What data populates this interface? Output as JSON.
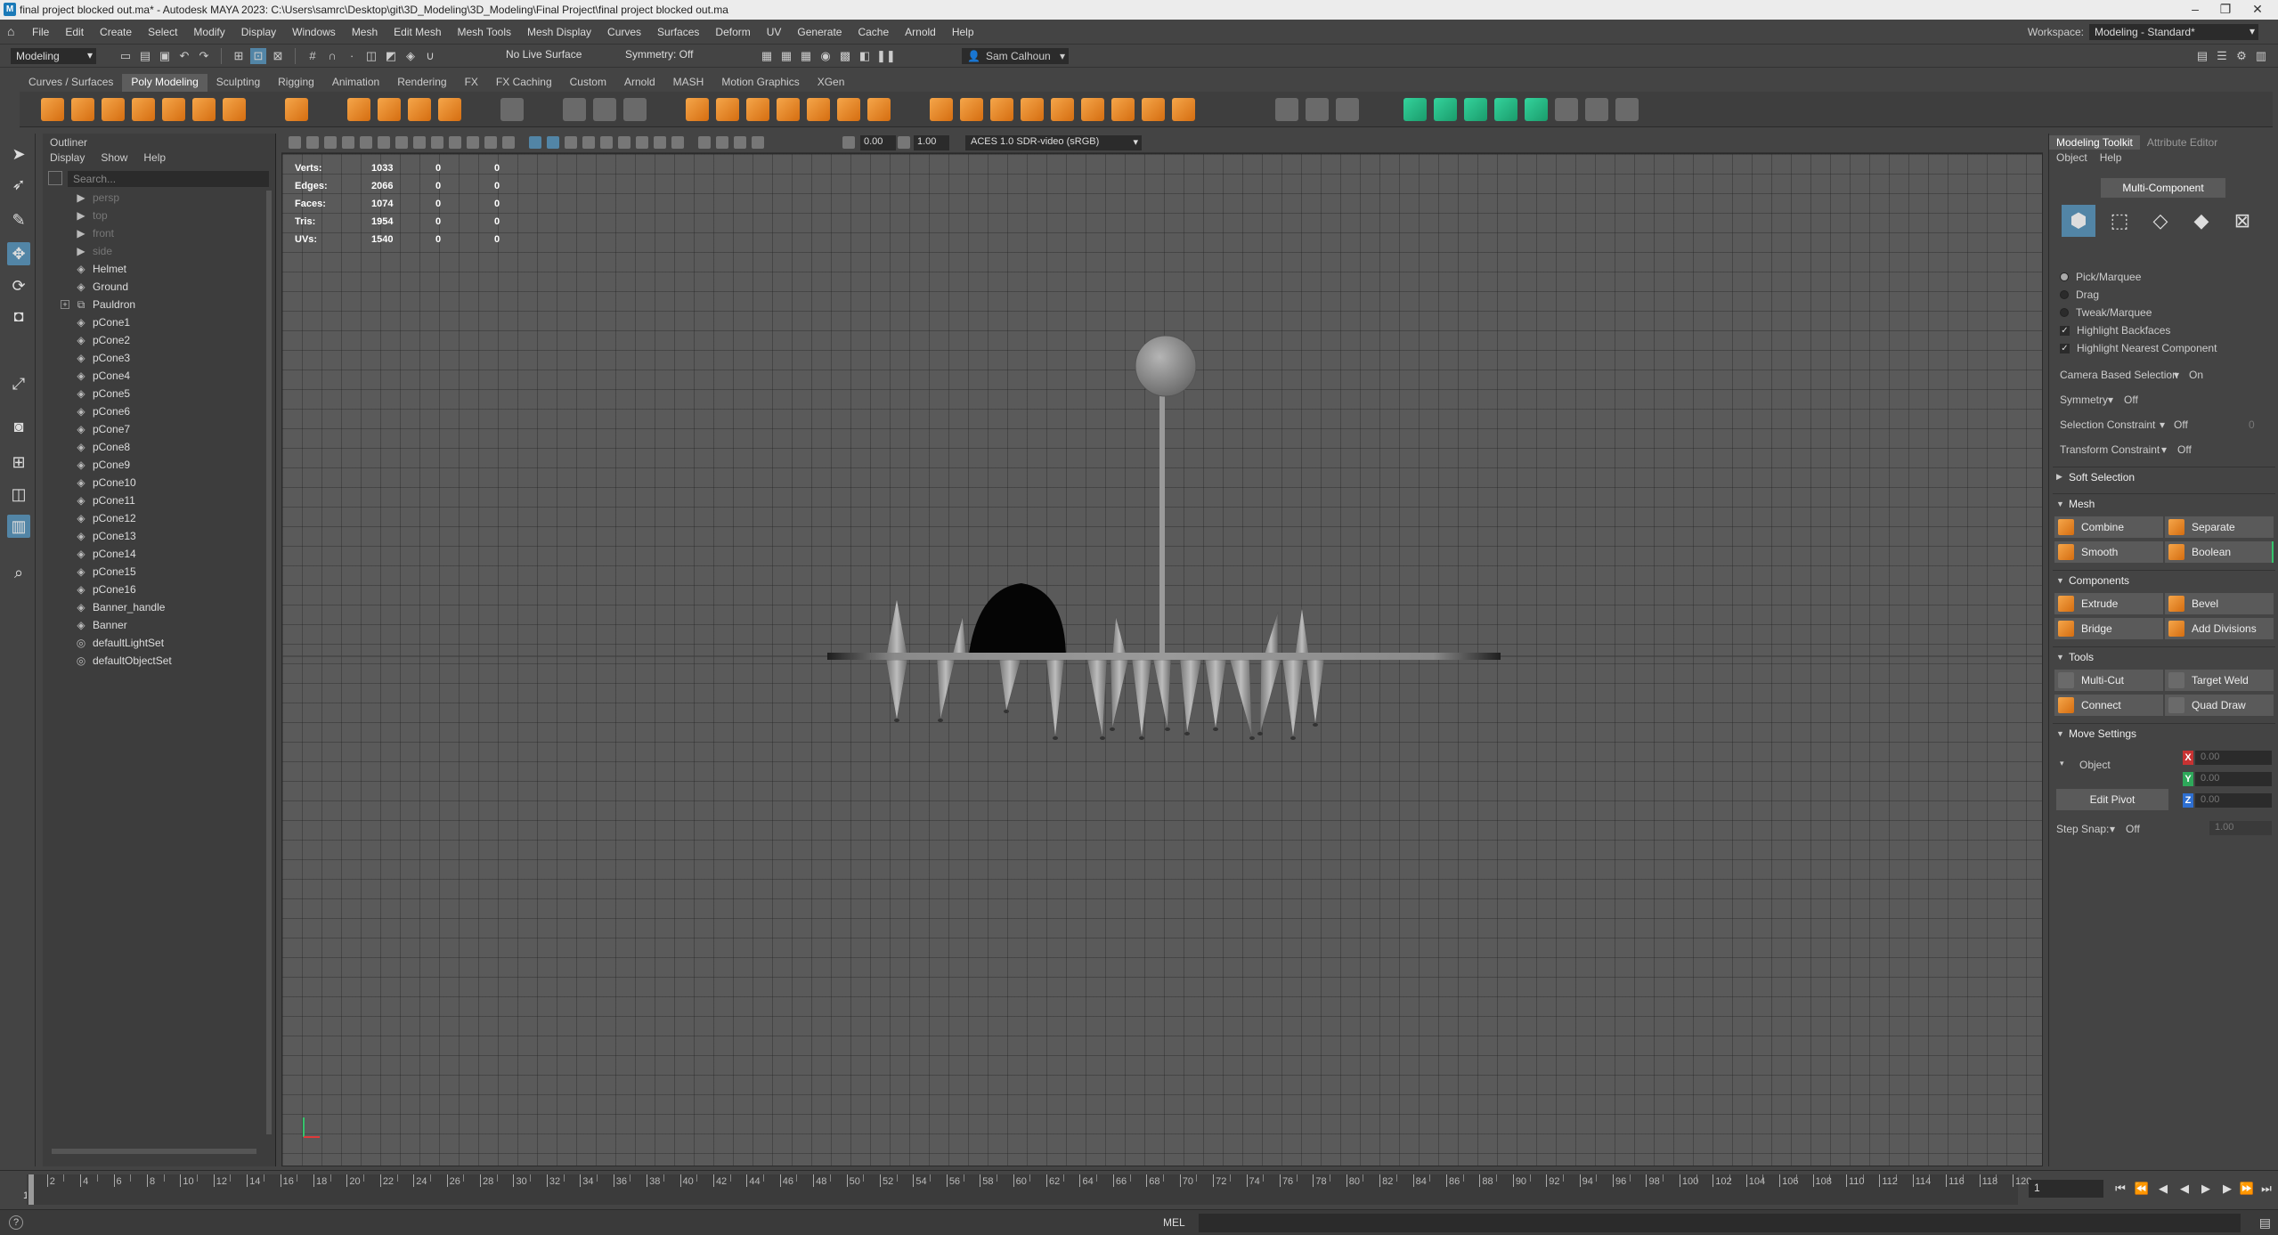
{
  "window": {
    "title": "final project blocked out.ma* - Autodesk MAYA 2023: C:\\Users\\samrc\\Desktop\\git\\3D_Modeling\\3D_Modeling\\Final Project\\final project blocked out.ma"
  },
  "menubar": {
    "items": [
      "File",
      "Edit",
      "Create",
      "Select",
      "Modify",
      "Display",
      "Windows",
      "Mesh",
      "Edit Mesh",
      "Mesh Tools",
      "Mesh Display",
      "Curves",
      "Surfaces",
      "Deform",
      "UV",
      "Generate",
      "Cache",
      "Arnold",
      "Help"
    ],
    "workspace_label": "Workspace:",
    "workspace_value": "Modeling - Standard*"
  },
  "statusline": {
    "mode": "Modeling",
    "live_surface": "No Live Surface",
    "symmetry": "Symmetry: Off",
    "user": "Sam Calhoun"
  },
  "shelf": {
    "tabs": [
      "Curves / Surfaces",
      "Poly Modeling",
      "Sculpting",
      "Rigging",
      "Animation",
      "Rendering",
      "FX",
      "FX Caching",
      "Custom",
      "Arnold",
      "MASH",
      "Motion Graphics",
      "XGen"
    ],
    "active_tab": "Poly Modeling"
  },
  "outliner": {
    "title": "Outliner",
    "menu": [
      "Display",
      "Show",
      "Help"
    ],
    "search_placeholder": "Search...",
    "items": [
      {
        "label": "persp",
        "icon": "camera-icon",
        "dim": true
      },
      {
        "label": "top",
        "icon": "camera-icon",
        "dim": true
      },
      {
        "label": "front",
        "icon": "camera-icon",
        "dim": true
      },
      {
        "label": "side",
        "icon": "camera-icon",
        "dim": true
      },
      {
        "label": "Helmet",
        "icon": "mesh-icon",
        "dim": false
      },
      {
        "label": "Ground",
        "icon": "mesh-icon",
        "dim": false
      },
      {
        "label": "Pauldron",
        "icon": "group-icon",
        "dim": false,
        "expandable": true
      },
      {
        "label": "pCone1",
        "icon": "mesh-icon",
        "dim": false
      },
      {
        "label": "pCone2",
        "icon": "mesh-icon",
        "dim": false
      },
      {
        "label": "pCone3",
        "icon": "mesh-icon",
        "dim": false
      },
      {
        "label": "pCone4",
        "icon": "mesh-icon",
        "dim": false
      },
      {
        "label": "pCone5",
        "icon": "mesh-icon",
        "dim": false
      },
      {
        "label": "pCone6",
        "icon": "mesh-icon",
        "dim": false
      },
      {
        "label": "pCone7",
        "icon": "mesh-icon",
        "dim": false
      },
      {
        "label": "pCone8",
        "icon": "mesh-icon",
        "dim": false
      },
      {
        "label": "pCone9",
        "icon": "mesh-icon",
        "dim": false
      },
      {
        "label": "pCone10",
        "icon": "mesh-icon",
        "dim": false
      },
      {
        "label": "pCone11",
        "icon": "mesh-icon",
        "dim": false
      },
      {
        "label": "pCone12",
        "icon": "mesh-icon",
        "dim": false
      },
      {
        "label": "pCone13",
        "icon": "mesh-icon",
        "dim": false
      },
      {
        "label": "pCone14",
        "icon": "mesh-icon",
        "dim": false
      },
      {
        "label": "pCone15",
        "icon": "mesh-icon",
        "dim": false
      },
      {
        "label": "pCone16",
        "icon": "mesh-icon",
        "dim": false
      },
      {
        "label": "Banner_handle",
        "icon": "mesh-icon",
        "dim": false
      },
      {
        "label": "Banner",
        "icon": "mesh-icon",
        "dim": false
      },
      {
        "label": "defaultLightSet",
        "icon": "set-icon",
        "dim": false
      },
      {
        "label": "defaultObjectSet",
        "icon": "set-icon",
        "dim": false
      }
    ]
  },
  "viewport": {
    "exposure": "0.00",
    "gamma": "1.00",
    "colorspace": "ACES 1.0 SDR-video (sRGB)",
    "hud": [
      {
        "label": "Verts:",
        "v1": "1033",
        "v2": "0",
        "v3": "0"
      },
      {
        "label": "Edges:",
        "v1": "2066",
        "v2": "0",
        "v3": "0"
      },
      {
        "label": "Faces:",
        "v1": "1074",
        "v2": "0",
        "v3": "0"
      },
      {
        "label": "Tris:",
        "v1": "1954",
        "v2": "0",
        "v3": "0"
      },
      {
        "label": "UVs:",
        "v1": "1540",
        "v2": "0",
        "v3": "0"
      }
    ]
  },
  "toolkit": {
    "tabs": [
      "Modeling Toolkit",
      "Attribute Editor"
    ],
    "menu": [
      "Object",
      "Help"
    ],
    "multi_component": "Multi-Component",
    "pick_marquee": "Pick/Marquee",
    "drag": "Drag",
    "tweak_marquee": "Tweak/Marquee",
    "highlight_backfaces": "Highlight Backfaces",
    "highlight_nearest": "Highlight Nearest Component",
    "camera_based_label": "Camera Based Selection",
    "camera_based_value": "On",
    "symmetry_label": "Symmetry",
    "symmetry_value": "Off",
    "sel_constraint_label": "Selection Constraint",
    "sel_constraint_value": "Off",
    "sel_constraint_num": "0",
    "transform_constraint_label": "Transform Constraint",
    "transform_constraint_value": "Off",
    "soft_selection": "Soft Selection",
    "sections": {
      "mesh": "Mesh",
      "components": "Components",
      "tools": "Tools",
      "move_settings": "Move Settings"
    },
    "mesh_buttons": [
      "Combine",
      "Separate",
      "Smooth",
      "Boolean"
    ],
    "component_buttons": [
      "Extrude",
      "Bevel",
      "Bridge",
      "Add Divisions"
    ],
    "tool_buttons": [
      "Multi-Cut",
      "Target Weld",
      "Connect",
      "Quad Draw"
    ],
    "object_label": "Object",
    "edit_pivot": "Edit Pivot",
    "x_val": "0.00",
    "y_val": "0.00",
    "z_val": "0.00",
    "step_snap_label": "Step Snap:",
    "step_snap_value": "Off",
    "step_snap_num": "1.00",
    "axis_x": "X",
    "axis_y": "Y",
    "axis_z": "Z"
  },
  "timeline": {
    "labels": [
      "2",
      "4",
      "6",
      "8",
      "10",
      "12",
      "14",
      "16",
      "18",
      "20",
      "22",
      "24",
      "26",
      "28",
      "30",
      "32",
      "34",
      "36",
      "38",
      "40",
      "42",
      "44",
      "46",
      "48",
      "50",
      "52",
      "54",
      "56",
      "58",
      "60",
      "62",
      "64",
      "66",
      "68",
      "70",
      "72",
      "74",
      "76",
      "78",
      "80",
      "82",
      "84",
      "86",
      "88",
      "90",
      "92",
      "94",
      "96",
      "98",
      "100",
      "102",
      "104",
      "106",
      "108",
      "110",
      "112",
      "114",
      "116",
      "118",
      "120"
    ],
    "start": "1",
    "current_frame": "1"
  },
  "cmdline": {
    "language": "MEL"
  },
  "colors": {
    "accent_blue": "#5285a6",
    "shelf_orange": "#f5a64a",
    "shelf_teal": "#34d39c",
    "maya_blue": "#1b7ab8"
  }
}
